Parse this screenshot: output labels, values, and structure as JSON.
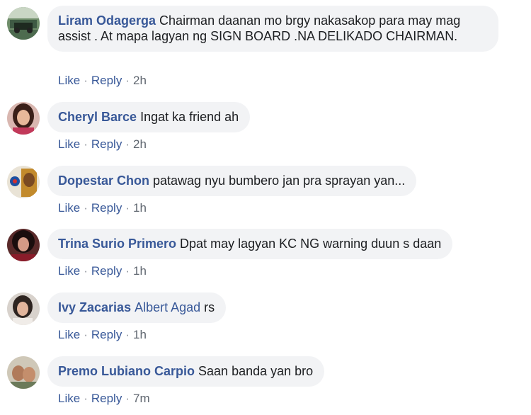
{
  "comments": [
    {
      "author": "Liram Odagerga",
      "text": "Chairman daanan mo brgy nakasakop para may mag assist . At mapa lagyan ng SIGN BOARD .NA DELIKADO CHAIRMAN.",
      "like": "Like",
      "reply": "Reply",
      "time": "2h"
    },
    {
      "author": "Cheryl Barce",
      "text": "Ingat ka friend ah",
      "like": "Like",
      "reply": "Reply",
      "time": "2h"
    },
    {
      "author": "Dopestar Chon",
      "text": "patawag nyu bumbero jan pra sprayan yan...",
      "like": "Like",
      "reply": "Reply",
      "time": "1h"
    },
    {
      "author": "Trina Surio Primero",
      "text": "Dpat may lagyan KC NG warning duun s daan",
      "like": "Like",
      "reply": "Reply",
      "time": "1h"
    },
    {
      "author": "Ivy Zacarias",
      "tag": "Albert Agad",
      "text": "rs",
      "like": "Like",
      "reply": "Reply",
      "time": "1h"
    },
    {
      "author": "Premo Lubiano Carpio",
      "text": "Saan banda yan bro",
      "like": "Like",
      "reply": "Reply",
      "time": "7m"
    }
  ],
  "colors": {
    "link": "#385898",
    "bubble": "#f2f3f5",
    "text": "#1c1e21",
    "meta": "#606770"
  },
  "separator": "·"
}
